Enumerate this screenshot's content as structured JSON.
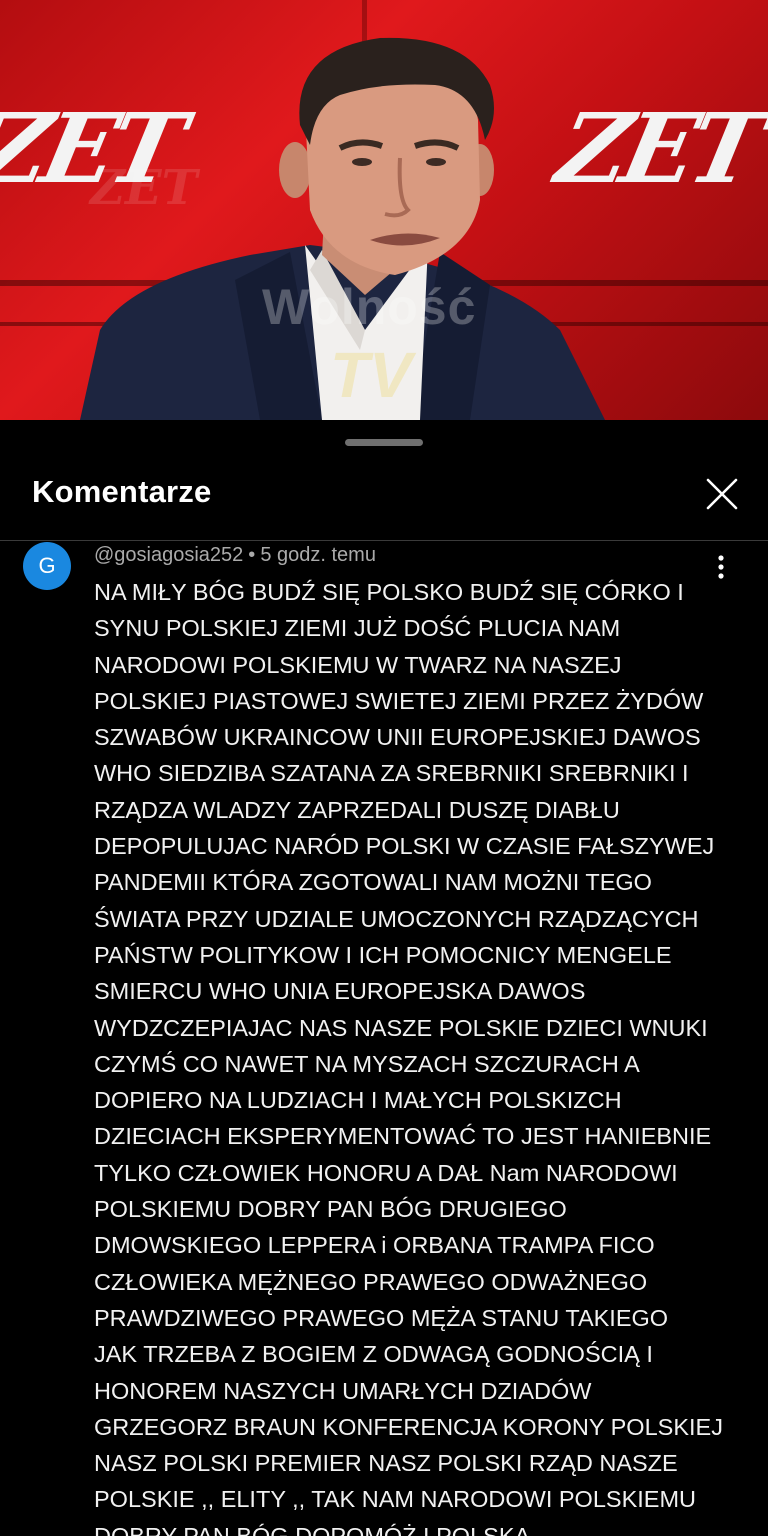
{
  "video": {
    "logo_text": "ZET",
    "watermark_text": "Wolność"
  },
  "comments_sheet": {
    "title": "Komentarze",
    "icons": {
      "close": "close-icon",
      "more": "more-vertical-icon"
    },
    "comments": [
      {
        "avatar_letter": "G",
        "avatar_color": "#1a88e0",
        "author": "@gosiagosia252",
        "separator": "•",
        "time": "5 godz. temu",
        "text_lines": [
          "NA MIŁY BÓG BUDŹ SIĘ POLSKO BUDŹ SIĘ CÓRKO I",
          "SYNU POLSKIEJ ZIEMI JUŻ DOŚĆ PLUCIA NAM",
          "NARODOWI POLSKIEMU W TWARZ NA NASZEJ",
          "POLSKIEJ PIASTOWEJ SWIETEJ ZIEMI PRZEZ ŻYDÓW",
          "SZWABÓW UKRAINCOW UNII EUROPEJSKIEJ DAWOS",
          "WHO SIEDZIBA SZATANA ZA SREBRNIKI SREBRNIKI I",
          "RZĄDZA WLADZY ZAPRZEDALI DUSZĘ DIABŁU",
          "DEPOPULUJAC NARÓD POLSKI W CZASIE FAŁSZYWEJ",
          "PANDEMII KTÓRA ZGOTOWALI NAM MOŻNI TEGO",
          "ŚWIATA PRZY UDZIALE UMOCZONYCH RZĄDZĄCYCH",
          "PAŃSTW POLITYKOW I ICH POMOCNICY MENGELE",
          "SMIERCU WHO UNIA EUROPEJSKA DAWOS",
          "WYDZCZEPIAJAC NAS NASZE POLSKIE DZIECI WNUKI",
          "CZYMŚ CO NAWET NA MYSZACH SZCZURACH A",
          "DOPIERO NA LUDZIACH I MAŁYCH POLSKIZCH",
          "DZIECIACH EKSPERYMENTOWAĆ TO JEST HANIEBNIE",
          "TYLKO CZŁOWIEK HONORU A DAŁ Nam NARODOWI",
          "POLSKIEMU DOBRY PAN BÓG DRUGIEGO",
          "DMOWSKIEGO LEPPERA i ORBANA TRAMPA FICO",
          "CZŁOWIEKA MĘŻNEGO PRAWEGO ODWAŻNEGO",
          "PRAWDZIWEGO PRAWEGO MĘŻA STANU TAKIEGO",
          "JAK TRZEBA Z BOGIEM Z ODWAGĄ GODNOŚCIĄ I",
          "HONOREM NASZYCH UMARŁYCH DZIADÓW",
          "GRZEGORZ BRAUN KONFERENCJA KORONY POLSKIEJ",
          "NASZ POLSKI PREMIER NASZ POLSKI RZĄD NASZE",
          "POLSKIE ,, ELITY ,, TAK NAM NARODOWI POLSKIEMU",
          "DOBRY PAN BÓG DOPOMÓŻ I POLSKA"
        ]
      }
    ]
  }
}
